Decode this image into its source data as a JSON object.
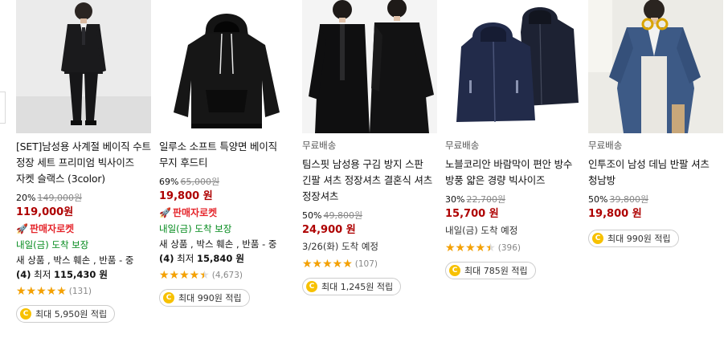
{
  "products": [
    {
      "free_shipping": "",
      "title": "[SET]남성용 사계절 베이직 수트 정장 세트 프리미엄 빅사이즈 자켓 슬랙스 (3color)",
      "discount_rate": "20%",
      "original_price": "149,000원",
      "price": "119,000원",
      "rocket_badge": "판매자로켓",
      "arrival": "내일(금) 도착 보장",
      "used_line1": "새 상품 , 박스 훼손 , 반품 - 중",
      "used_count": "(4)",
      "used_min_label": "최저",
      "used_min_price": "115,430 원",
      "rating": 5.0,
      "review_count": "(131)",
      "reward": "최대 5,950원 적립"
    },
    {
      "free_shipping": "",
      "title": "일루소 소프트 특양면 베이직 무지 후드티",
      "discount_rate": "69%",
      "original_price": "65,000원",
      "price": "19,800 원",
      "rocket_badge": "판매자로켓",
      "arrival": "내일(금) 도착 보장",
      "used_line1": "새 상품 , 박스 훼손 , 반품 - 중",
      "used_count": "(4)",
      "used_min_label": "최저",
      "used_min_price": "15,840 원",
      "rating": 4.5,
      "review_count": "(4,673)",
      "reward": "최대 990원 적립"
    },
    {
      "free_shipping": "무료배송",
      "title": "팀스핏 남성용 구김 방지 스판 긴팔 셔츠 정장셔츠 결혼식 셔츠 정장셔츠",
      "discount_rate": "50%",
      "original_price": "49,800원",
      "price": "24,900 원",
      "arrival_gray": "3/26(화) 도착 예정",
      "rating": 5.0,
      "review_count": "(107)",
      "reward": "최대 1,245원 적립"
    },
    {
      "free_shipping": "무료배송",
      "title": "노블코리안 바람막이 편안 방수 방풍 얇은 경량 빅사이즈",
      "discount_rate": "30%",
      "original_price": "22,700원",
      "price": "15,700 원",
      "arrival_gray": "내일(금) 도착 예정",
      "rating": 4.5,
      "review_count": "(396)",
      "reward": "최대 785원 적립"
    },
    {
      "free_shipping": "무료배송",
      "title": "인투조이 남성 데님 반팔 셔츠 청남방",
      "discount_rate": "50%",
      "original_price": "39,800원",
      "price": "19,800 원",
      "reward": "최대 990원 적립"
    }
  ],
  "icons": {
    "rocket": "rocket-icon",
    "coin": "coin-icon",
    "star": "star-icon"
  },
  "colors": {
    "price": "#ae0000",
    "rocket": "#e5262c",
    "arrival": "#00891a",
    "star": "#f5a100",
    "coin": "#f7c100"
  }
}
